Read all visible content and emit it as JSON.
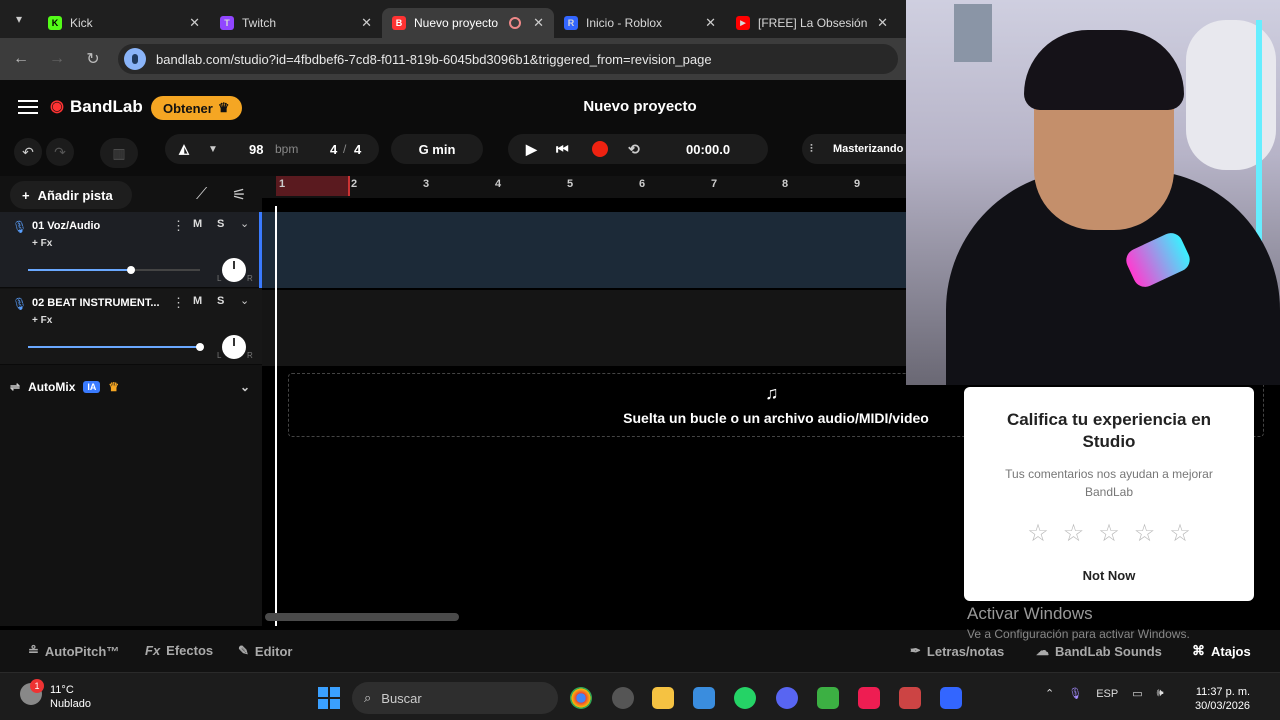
{
  "browser": {
    "tabs": [
      {
        "label": "Kick",
        "color": "#53fc18",
        "glyph": "K"
      },
      {
        "label": "Twitch",
        "color": "#9146ff",
        "glyph": "T"
      },
      {
        "label": "Nuevo proyecto",
        "color": "#ff3333",
        "glyph": "B"
      },
      {
        "label": "Inicio - Roblox",
        "color": "#3366ff",
        "glyph": "R"
      },
      {
        "label": "[FREE] La Obsesión Fr",
        "color": "#ff0000",
        "glyph": "▶"
      }
    ],
    "url": "bandlab.com/studio?id=4fbdbef6-7cd8-f011-819b-6045bd3096b1&triggered_from=revision_page"
  },
  "header": {
    "brand": "BandLab",
    "obtener_label": "Obtener",
    "project_title": "Nuevo proyecto"
  },
  "toolbar": {
    "tempo": "98",
    "tempo_unit": "bpm",
    "time_sig_num": "4",
    "time_sig_den": "4",
    "key": "G min",
    "time_display": "00:00.0",
    "mastering_label": "Masterizando"
  },
  "left_panel": {
    "add_track_label": "Añadir pista",
    "tracks": [
      {
        "name": "01  Voz/Audio",
        "fx": "+ Fx",
        "m": "M",
        "s": "S",
        "volume": 0.6
      },
      {
        "name": "02  BEAT INSTRUMENT...",
        "fx": "+ Fx",
        "m": "M",
        "s": "S",
        "volume": 1.0
      }
    ],
    "pan_l": "L",
    "pan_r": "R",
    "automix_label": "AutoMix",
    "ia_badge": "IA"
  },
  "timeline": {
    "ticks": [
      "1",
      "2",
      "3",
      "4",
      "5",
      "6",
      "7",
      "8",
      "9"
    ],
    "drop_text": "Suelta un bucle o un archivo audio/MIDI/video"
  },
  "bottom_bar": {
    "autopitch": "AutoPitch™",
    "efectos": "Efectos",
    "fx_prefix": "Fx",
    "editor": "Editor",
    "letras": "Letras/notas",
    "sounds": "BandLab Sounds",
    "atajos": "Atajos"
  },
  "rating_popup": {
    "title": "Califica tu experiencia en Studio",
    "subtitle": "Tus comentarios nos ayudan a mejorar BandLab",
    "stars": [
      "☆",
      "☆",
      "☆",
      "☆",
      "☆"
    ],
    "not_now": "Not Now"
  },
  "watermark": {
    "line1": "Activar Windows",
    "line2": "Ve a Configuración para activar Windows."
  },
  "taskbar": {
    "temperature": "11°C",
    "weather": "Nublado",
    "weather_badge": "1",
    "search_placeholder": "Buscar",
    "lang": "ESP",
    "time": "11:37 p. m.",
    "date": "30/03/2026"
  },
  "colors": {
    "accent": "#f5a623",
    "brand_red": "#ff3333",
    "selected_lane": "#1c2a38"
  }
}
